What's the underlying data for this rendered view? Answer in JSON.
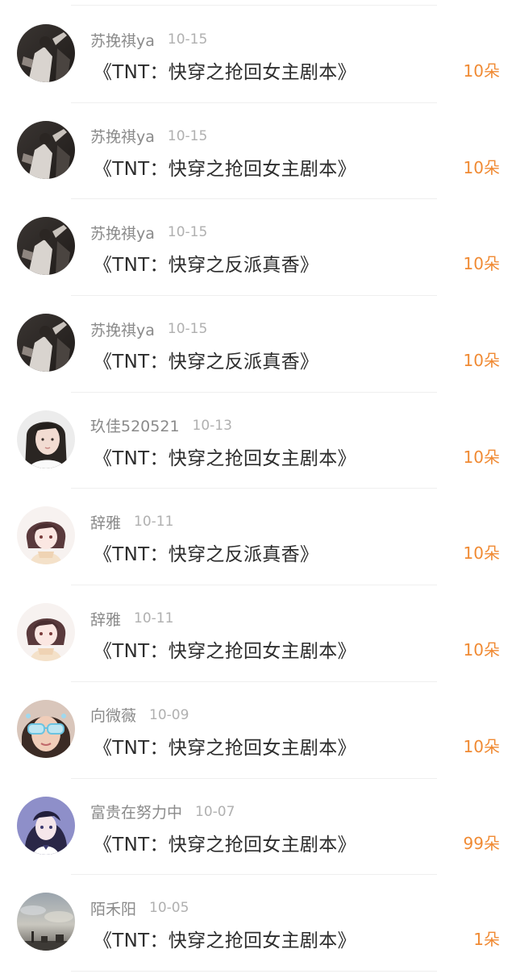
{
  "gift_list": {
    "items": [
      {
        "user": "苏挽祺ya",
        "date": "10-15",
        "title": "《TNT：快穿之抢回女主剧本》",
        "amount": "10朵",
        "avatar": "dark-performer-avatar"
      },
      {
        "user": "苏挽祺ya",
        "date": "10-15",
        "title": "《TNT：快穿之抢回女主剧本》",
        "amount": "10朵",
        "avatar": "dark-performer-avatar"
      },
      {
        "user": "苏挽祺ya",
        "date": "10-15",
        "title": "《TNT：快穿之反派真香》",
        "amount": "10朵",
        "avatar": "dark-performer-avatar"
      },
      {
        "user": "苏挽祺ya",
        "date": "10-15",
        "title": "《TNT：快穿之反派真香》",
        "amount": "10朵",
        "avatar": "dark-performer-avatar"
      },
      {
        "user": "玖佳520521",
        "date": "10-13",
        "title": "《TNT：快穿之抢回女主剧本》",
        "amount": "10朵",
        "avatar": "girl-photo-avatar"
      },
      {
        "user": "辞雅",
        "date": "10-11",
        "title": "《TNT：快穿之反派真香》",
        "amount": "10朵",
        "avatar": "anime-girl-avatar"
      },
      {
        "user": "辞雅",
        "date": "10-11",
        "title": "《TNT：快穿之抢回女主剧本》",
        "amount": "10朵",
        "avatar": "anime-girl-avatar"
      },
      {
        "user": "向微薇",
        "date": "10-09",
        "title": "《TNT：快穿之抢回女主剧本》",
        "amount": "10朵",
        "avatar": "sunglasses-girl-avatar"
      },
      {
        "user": "富贵在努力中",
        "date": "10-07",
        "title": "《TNT：快穿之抢回女主剧本》",
        "amount": "99朵",
        "avatar": "anime-portrait-avatar"
      },
      {
        "user": "陌禾阳",
        "date": "10-05",
        "title": "《TNT：快穿之抢回女主剧本》",
        "amount": "1朵",
        "avatar": "sky-landscape-avatar"
      }
    ]
  },
  "colors": {
    "amount": "#f08a33",
    "username": "#8a8a8a",
    "date": "#b0b0b0",
    "title": "#2d2d2d",
    "divider": "#efefef"
  }
}
